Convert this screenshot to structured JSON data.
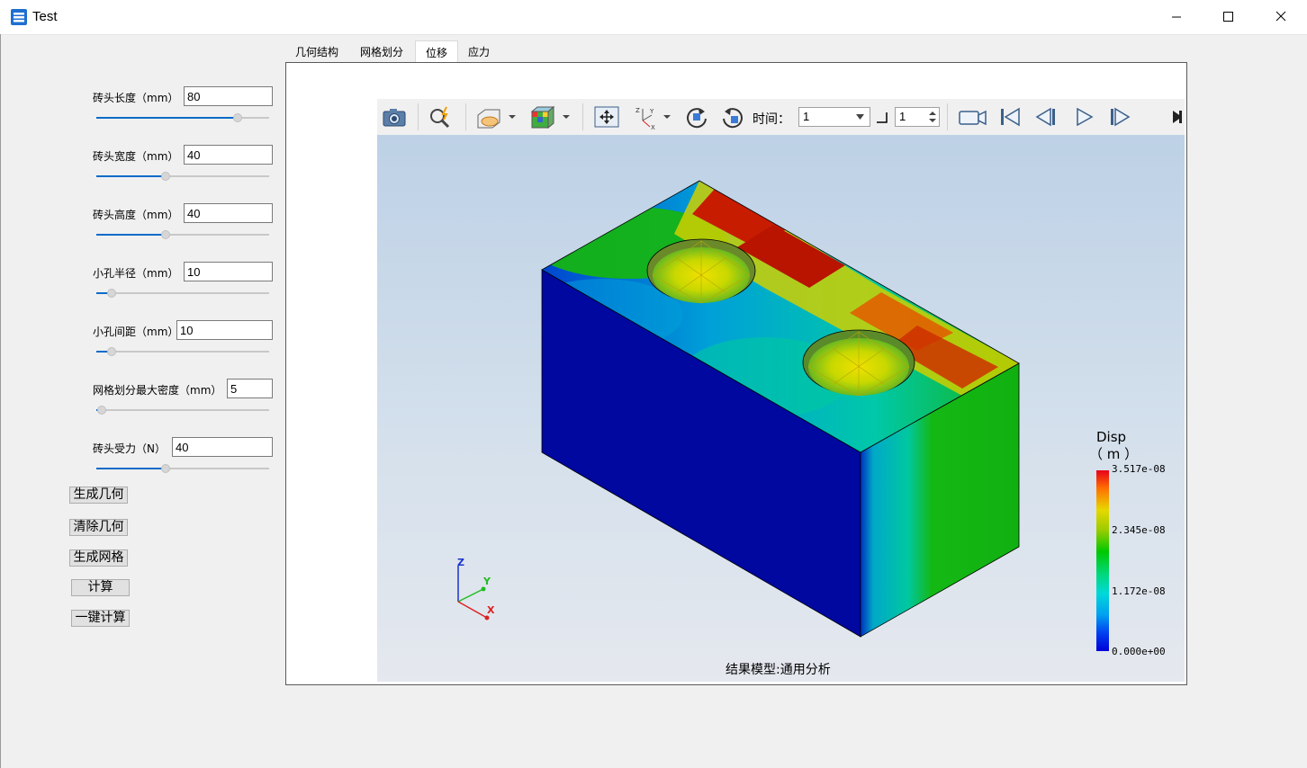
{
  "window": {
    "title": "Test"
  },
  "params": [
    {
      "label": "砖头长度（mm）",
      "value": "80",
      "slider_fraction": 0.82
    },
    {
      "label": "砖头宽度（mm）",
      "value": "40",
      "slider_fraction": 0.4
    },
    {
      "label": "砖头高度（mm）",
      "value": "40",
      "slider_fraction": 0.4
    },
    {
      "label": "小孔半径（mm）",
      "value": "10",
      "slider_fraction": 0.09
    },
    {
      "label": "小孔间距（mm）",
      "value": "10",
      "slider_fraction": 0.09
    },
    {
      "label": "网格划分最大密度（mm）",
      "value": "5",
      "slider_fraction": 0.03
    },
    {
      "label": "砖头受力（N）",
      "value": "40",
      "slider_fraction": 0.4
    }
  ],
  "buttons": {
    "gen_geometry": "生成几何",
    "clear_geometry": "清除几何",
    "gen_mesh": "生成网格",
    "compute": "计算",
    "one_click": "一键计算"
  },
  "tabs": [
    "几何结构",
    "网格划分",
    "位移",
    "应力"
  ],
  "active_tab": "位移",
  "toolbar": {
    "time_label": "时间：",
    "time_value": "1",
    "step_value": "1",
    "icons": [
      "camera-icon",
      "query-icon",
      "section-view-icon",
      "render-style-icon",
      "fit-view-icon",
      "axis-orient-icon",
      "rotate-cw-icon",
      "rotate-ccw-icon",
      "record-icon",
      "first-frame-icon",
      "prev-frame-icon",
      "play-icon",
      "next-frame-icon",
      "expand-icon"
    ]
  },
  "legend": {
    "title_line1": "Disp",
    "title_line2": "（ m ）",
    "ticks": [
      "3.517e-08",
      "2.345e-08",
      "1.172e-08",
      "0.000e+00"
    ]
  },
  "caption": "结果模型:通用分析",
  "triad": {
    "x": "X",
    "y": "Y",
    "z": "Z"
  }
}
